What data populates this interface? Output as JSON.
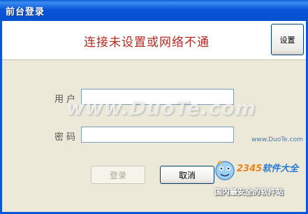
{
  "window": {
    "title": "前台登录"
  },
  "header": {
    "status_message": "连接未设置或网络不通",
    "settings_label": "设置"
  },
  "form": {
    "username_label": "用户",
    "username_value": "",
    "password_label": "密码",
    "password_value": ""
  },
  "actions": {
    "login_label": "登录",
    "cancel_label": "取消"
  },
  "watermark": {
    "text": "www.DuoTe.com",
    "url": "www.DuoTe.com"
  },
  "brand": {
    "logo_number": "2345",
    "logo_text": "软件大全",
    "slogan": "国内最安全的软件站"
  },
  "colors": {
    "title_bar": "#0a56d8",
    "status_text": "#b22a22",
    "dialog_background": "#ece9d8"
  }
}
